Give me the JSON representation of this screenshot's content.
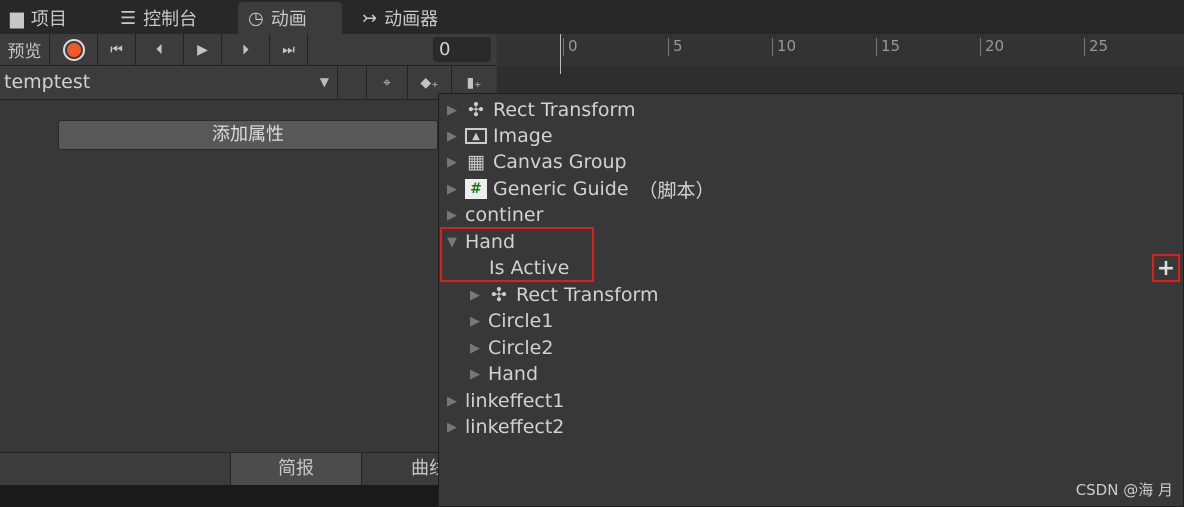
{
  "tabs": [
    {
      "label": "项目",
      "icon": "folder-icon"
    },
    {
      "label": "控制台",
      "icon": "console-icon"
    },
    {
      "label": "动画",
      "icon": "clock-icon",
      "active": true
    },
    {
      "label": "动画器",
      "icon": "animator-icon"
    }
  ],
  "toolbar": {
    "preview": "预览",
    "frame_value": "0",
    "record_color": "#f05a2a"
  },
  "ruler": {
    "ticks": [
      "0",
      "5",
      "10",
      "15",
      "20",
      "25"
    ]
  },
  "clip": {
    "name": "temptest"
  },
  "add_property": "添加属性",
  "bottom_tabs": {
    "dopesheet": "简报",
    "curves": "曲线"
  },
  "popup": {
    "items": [
      {
        "label": "Rect Transform",
        "icon": "rect-transform-icon"
      },
      {
        "label": "Image",
        "icon": "image-icon"
      },
      {
        "label": "Canvas Group",
        "icon": "canvas-group-icon"
      },
      {
        "label": "Generic Guide",
        "suffix": "（脚本）",
        "icon": "script-icon"
      },
      {
        "label": "continer"
      },
      {
        "label": "Hand",
        "expanded": true
      },
      {
        "label": "Is Active"
      },
      {
        "label": "Rect Transform",
        "icon": "rect-transform-icon"
      },
      {
        "label": "Circle1"
      },
      {
        "label": "Circle2"
      },
      {
        "label": "Hand"
      },
      {
        "label": "linkeffect1"
      },
      {
        "label": "linkeffect2"
      }
    ]
  },
  "watermark": "CSDN @海 月",
  "highlight_color": "#e01c1c"
}
